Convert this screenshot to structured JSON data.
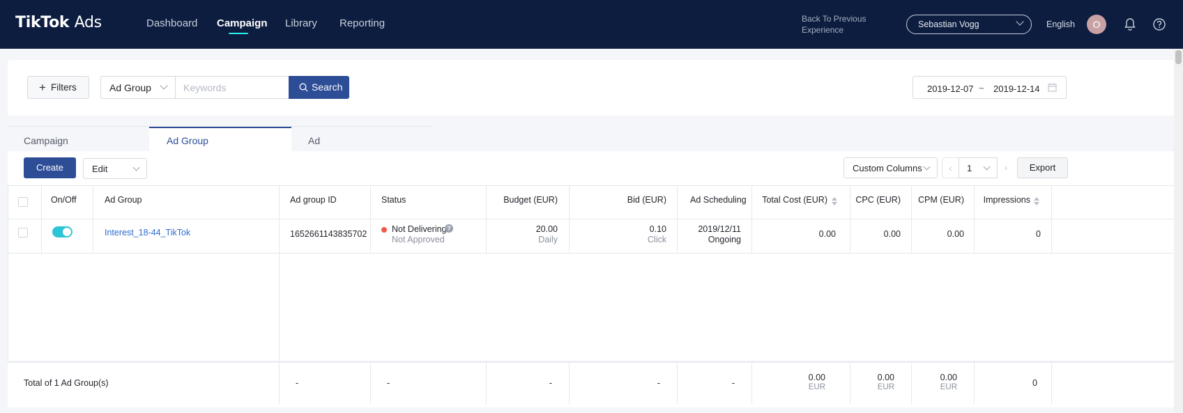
{
  "brand": {
    "name": "TikTok",
    "suffix": "Ads"
  },
  "nav": {
    "items": [
      "Dashboard",
      "Campaign",
      "Library",
      "Reporting"
    ],
    "active": "Campaign",
    "back_link": "Back To Previous Experience",
    "account": "Sebastian Vogg",
    "language": "English",
    "avatar_initial": "O"
  },
  "filters": {
    "filters_label": "Filters",
    "dimension": "Ad Group",
    "keyword_placeholder": "Keywords",
    "search_label": "Search",
    "date_start": "2019-12-07",
    "date_sep": "~",
    "date_end": "2019-12-14"
  },
  "tabs": [
    "Campaign",
    "Ad Group",
    "Ad"
  ],
  "active_tab": "Ad Group",
  "toolbar": {
    "create_label": "Create",
    "edit_label": "Edit",
    "custom_columns_label": "Custom Columns",
    "page": "1",
    "export_label": "Export"
  },
  "table": {
    "columns": [
      "On/Off",
      "Ad Group",
      "Ad group ID",
      "Status",
      "Budget (EUR)",
      "Bid (EUR)",
      "Ad Scheduling",
      "Total Cost (EUR)",
      "CPC (EUR)",
      "CPM (EUR)",
      "Impressions"
    ],
    "rows": [
      {
        "enabled": true,
        "ad_group": "Interest_18-44_TikTok",
        "ad_group_id": "1652661143835702",
        "status": "Not Delivering",
        "status_sub": "Not Approved",
        "budget": "20.00",
        "budget_sub": "Daily",
        "bid": "0.10",
        "bid_sub": "Click",
        "schedule_date": "2019/12/11",
        "schedule_sub": "Ongoing",
        "total_cost": "0.00",
        "cpc": "0.00",
        "cpm": "0.00",
        "impressions": "0"
      }
    ],
    "footer": {
      "label": "Total of 1 Ad Group(s)",
      "ad_group_id": "-",
      "status": "-",
      "budget": "-",
      "bid": "-",
      "schedule": "-",
      "total_cost": "0.00",
      "cpc": "0.00",
      "cpm": "0.00",
      "currency": "EUR",
      "impressions": "0"
    }
  },
  "colors": {
    "nav_bg": "#0d1d3f",
    "primary": "#2d4d96",
    "accent": "#25f4ee",
    "toggle_on": "#2ec4d8",
    "status_error": "#f2574a",
    "link": "#2d6bd0"
  }
}
